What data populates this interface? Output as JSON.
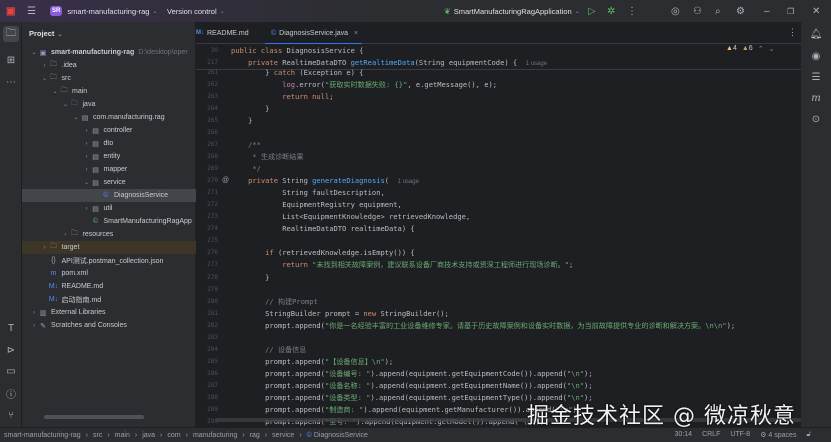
{
  "titlebar": {
    "project_badge": "SR",
    "project_name": "smart-manufacturing-rag",
    "vcs": "Version control",
    "run_config": "SmartManufacturingRagApplication"
  },
  "project_panel": {
    "title": "Project",
    "tree": [
      {
        "label": "smart-manufacturing-rag",
        "hint": "D:\\desktop\\oper",
        "level": 0,
        "arrow": "open",
        "icon": "module",
        "bold": true
      },
      {
        "label": ".idea",
        "level": 1,
        "arrow": "closed",
        "icon": "folder"
      },
      {
        "label": "src",
        "level": 1,
        "arrow": "open",
        "icon": "folder"
      },
      {
        "label": "main",
        "level": 2,
        "arrow": "open",
        "icon": "folder"
      },
      {
        "label": "java",
        "level": 3,
        "arrow": "open",
        "icon": "src-folder"
      },
      {
        "label": "com.manufacturing.rag",
        "level": 4,
        "arrow": "open",
        "icon": "package"
      },
      {
        "label": "controller",
        "level": 5,
        "arrow": "closed",
        "icon": "package"
      },
      {
        "label": "dto",
        "level": 5,
        "arrow": "closed",
        "icon": "package"
      },
      {
        "label": "entity",
        "level": 5,
        "arrow": "closed",
        "icon": "package"
      },
      {
        "label": "mapper",
        "level": 5,
        "arrow": "closed",
        "icon": "package"
      },
      {
        "label": "service",
        "level": 5,
        "arrow": "open",
        "icon": "package"
      },
      {
        "label": "DiagnosisService",
        "level": 6,
        "arrow": "none",
        "icon": "class",
        "selected": true
      },
      {
        "label": "util",
        "level": 5,
        "arrow": "closed",
        "icon": "package"
      },
      {
        "label": "SmartManufacturingRagApp",
        "level": 5,
        "arrow": "none",
        "icon": "spring-class"
      },
      {
        "label": "resources",
        "level": 3,
        "arrow": "closed",
        "icon": "res-folder"
      },
      {
        "label": "target",
        "level": 1,
        "arrow": "closed",
        "icon": "excluded-folder",
        "highlight": true
      },
      {
        "label": "API测试.postman_collection.json",
        "level": 1,
        "arrow": "none",
        "icon": "json"
      },
      {
        "label": "pom.xml",
        "level": 1,
        "arrow": "none",
        "icon": "maven"
      },
      {
        "label": "README.md",
        "level": 1,
        "arrow": "none",
        "icon": "markdown"
      },
      {
        "label": "启动指南.md",
        "level": 1,
        "arrow": "none",
        "icon": "markdown"
      },
      {
        "label": "External Libraries",
        "level": 0,
        "arrow": "closed",
        "icon": "library"
      },
      {
        "label": "Scratches and Consoles",
        "level": 0,
        "arrow": "closed",
        "icon": "scratch"
      }
    ]
  },
  "tabs": [
    {
      "label": "README.md",
      "icon": "markdown"
    },
    {
      "label": "DiagnosisService.java",
      "icon": "class",
      "active": true
    }
  ],
  "inspections": {
    "warnings": "4",
    "weak_warnings": "6"
  },
  "sticky_lines": [
    {
      "num": "30",
      "tokens": [
        [
          "public class ",
          "k"
        ],
        [
          "DiagnosisService",
          ""
        ],
        [
          " {",
          ""
        ]
      ]
    },
    {
      "num": "217",
      "tokens": [
        [
          "    private ",
          "k"
        ],
        [
          "RealtimeDataDTO ",
          ""
        ],
        [
          "getRealtimeData",
          "m"
        ],
        [
          "(String equipmentCode) {  ",
          ""
        ],
        [
          "1 usage",
          "u"
        ]
      ]
    }
  ],
  "code_lines": [
    {
      "num": "261",
      "tokens": [
        [
          "        } ",
          ""
        ],
        [
          "catch ",
          "k"
        ],
        [
          "(Exception e) {",
          ""
        ]
      ]
    },
    {
      "num": "262",
      "tokens": [
        [
          "            ",
          ""
        ],
        [
          "log",
          "f"
        ],
        [
          ".error(",
          ""
        ],
        [
          "\"获取实时数据失败: {}\"",
          "s"
        ],
        [
          ", e.getMessage(), e);",
          ""
        ]
      ]
    },
    {
      "num": "263",
      "tokens": [
        [
          "            ",
          ""
        ],
        [
          "return null",
          "k"
        ],
        [
          ";",
          ""
        ]
      ]
    },
    {
      "num": "264",
      "tokens": [
        [
          "        }",
          ""
        ]
      ]
    },
    {
      "num": "265",
      "tokens": [
        [
          "    }",
          ""
        ]
      ]
    },
    {
      "num": "266",
      "tokens": []
    },
    {
      "num": "267",
      "tokens": [
        [
          "    /**",
          "c"
        ]
      ]
    },
    {
      "num": "268",
      "tokens": [
        [
          "     * 生成诊断结果",
          "c"
        ]
      ]
    },
    {
      "num": "269",
      "tokens": [
        [
          "     */",
          "c"
        ]
      ]
    },
    {
      "num": "270",
      "tokens": [
        [
          "    private ",
          "k"
        ],
        [
          "String ",
          ""
        ],
        [
          "generateDiagnosis",
          "m"
        ],
        [
          "(  ",
          ""
        ],
        [
          "1 usage",
          "u"
        ]
      ],
      "gutter_icon": "override"
    },
    {
      "num": "271",
      "tokens": [
        [
          "            String faultDescription,",
          ""
        ]
      ]
    },
    {
      "num": "272",
      "tokens": [
        [
          "            EquipmentRegistry equipment,",
          ""
        ]
      ]
    },
    {
      "num": "273",
      "tokens": [
        [
          "            List<EquipmentKnowledge> retrievedKnowledge,",
          ""
        ]
      ]
    },
    {
      "num": "274",
      "tokens": [
        [
          "            RealtimeDataDTO realtimeData) {",
          ""
        ]
      ]
    },
    {
      "num": "275",
      "tokens": []
    },
    {
      "num": "276",
      "tokens": [
        [
          "        ",
          ""
        ],
        [
          "if ",
          "k"
        ],
        [
          "(retrievedKnowledge.isEmpty()) {",
          ""
        ]
      ]
    },
    {
      "num": "277",
      "tokens": [
        [
          "            ",
          ""
        ],
        [
          "return ",
          "k"
        ],
        [
          "\"未找到相关故障案例，建议联系设备厂商技术支持或资深工程师进行现场诊断。\"",
          "s"
        ],
        [
          ";",
          ""
        ]
      ]
    },
    {
      "num": "278",
      "tokens": [
        [
          "        }",
          ""
        ]
      ]
    },
    {
      "num": "279",
      "tokens": []
    },
    {
      "num": "280",
      "tokens": [
        [
          "        // 构建Prompt",
          "c"
        ]
      ]
    },
    {
      "num": "281",
      "tokens": [
        [
          "        StringBuilder prompt = ",
          ""
        ],
        [
          "new ",
          "k"
        ],
        [
          "StringBuilder();",
          ""
        ]
      ]
    },
    {
      "num": "282",
      "tokens": [
        [
          "        prompt.append(",
          ""
        ],
        [
          "\"你是一名经验丰富的工业设备维修专家。请基于历史故障案例和设备实时数据，为当前故障提供专业的诊断和解决方案。\\n\\n\"",
          "s"
        ],
        [
          ");",
          ""
        ]
      ]
    },
    {
      "num": "283",
      "tokens": []
    },
    {
      "num": "284",
      "tokens": [
        [
          "        // 设备信息",
          "c"
        ]
      ]
    },
    {
      "num": "285",
      "tokens": [
        [
          "        prompt.append(",
          ""
        ],
        [
          "\"【设备信息】\\n\"",
          "s"
        ],
        [
          ");",
          ""
        ]
      ]
    },
    {
      "num": "286",
      "tokens": [
        [
          "        prompt.append(",
          ""
        ],
        [
          "\"设备编号: \"",
          "s"
        ],
        [
          ").append(equipment.getEquipmentCode()).append(",
          ""
        ],
        [
          "\"\\n\"",
          "s"
        ],
        [
          ");",
          ""
        ]
      ]
    },
    {
      "num": "287",
      "tokens": [
        [
          "        prompt.append(",
          ""
        ],
        [
          "\"设备名称: \"",
          "s"
        ],
        [
          ").append(equipment.getEquipmentName()).append(",
          ""
        ],
        [
          "\"\\n\"",
          "s"
        ],
        [
          ");",
          ""
        ]
      ]
    },
    {
      "num": "288",
      "tokens": [
        [
          "        prompt.append(",
          ""
        ],
        [
          "\"设备类型: \"",
          "s"
        ],
        [
          ").append(equipment.getEquipmentType()).append(",
          ""
        ],
        [
          "\"\\n\"",
          "s"
        ],
        [
          ");",
          ""
        ]
      ]
    },
    {
      "num": "289",
      "tokens": [
        [
          "        prompt.append(",
          ""
        ],
        [
          "\"制造商: \"",
          "s"
        ],
        [
          ").append(equipment.getManufacturer()).append(",
          ""
        ],
        [
          "\"\\n\"",
          "s"
        ],
        [
          ");",
          ""
        ]
      ]
    },
    {
      "num": "290",
      "tokens": [
        [
          "        prompt.append(",
          ""
        ],
        [
          "\"型号: \"",
          "s"
        ],
        [
          ").append(equipment.getModel()).append(",
          ""
        ],
        [
          "\"\\n\"",
          "s"
        ],
        [
          ");",
          ""
        ]
      ]
    }
  ],
  "breadcrumb": [
    "smart-manufacturing-rag",
    "src",
    "main",
    "java",
    "com",
    "manufacturing",
    "rag",
    "service",
    "DiagnosisService"
  ],
  "status": {
    "position": "30:14",
    "line_sep": "CRLF",
    "encoding": "UTF-8",
    "indent": "4 spaces"
  },
  "watermark": "掘金技术社区 @ 微凉秋意",
  "colors": {
    "accent": "#3574f0",
    "keyword": "#cf8e6d",
    "string": "#6aab73",
    "method": "#56a8f5",
    "comment": "#7a7e85"
  }
}
